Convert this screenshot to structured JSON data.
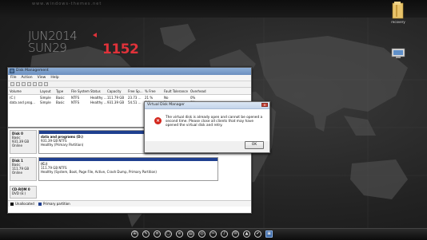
{
  "desktop": {
    "top_text": "www.windows-themes.net",
    "clock": {
      "date_line1": "JUN2014",
      "date_line2": "SUN29",
      "time": "1152"
    },
    "icons": [
      {
        "label": "recovery",
        "icon": "folder-icon"
      },
      {
        "label": "",
        "icon": "desktop-shortcut-icon"
      }
    ]
  },
  "disk_manager": {
    "title": "Disk Management",
    "menu": [
      "File",
      "Action",
      "View",
      "Help"
    ],
    "table": {
      "columns": [
        "Volume",
        "Layout",
        "Type",
        "File System",
        "Status",
        "Capacity",
        "Free Sp...",
        "% Free",
        "Fault Tolerance",
        "Overhead"
      ],
      "rows": [
        [
          "(C:)",
          "Simple",
          "Basic",
          "NTFS",
          "Healthy ...",
          "111.79 GB",
          "23.73 ...",
          "21 %",
          "No",
          "0%"
        ],
        [
          "data and prog...",
          "Simple",
          "Basic",
          "NTFS",
          "Healthy ...",
          "931.39 GB",
          "54.51 ...",
          "6 %",
          "No",
          "0%"
        ]
      ]
    },
    "disks": [
      {
        "name": "Disk 0",
        "type": "Basic",
        "size": "931.39 GB",
        "status": "Online",
        "partition": {
          "label": "data and programs (D:)",
          "detail1": "931.39 GB NTFS",
          "detail2": "Healthy (Primary Partition)"
        }
      },
      {
        "name": "Disk 1",
        "type": "Basic",
        "size": "111.79 GB",
        "status": "Online",
        "partition": {
          "label": "(C:)",
          "detail1": "111.79 GB NTFS",
          "detail2": "Healthy (System, Boot, Page File, Active, Crash Dump, Primary Partition)"
        }
      },
      {
        "name": "CD-ROM 0",
        "type": "DVD (E:)",
        "size": "",
        "status": "",
        "partition": {
          "label": "",
          "detail1": "",
          "detail2": ""
        }
      }
    ],
    "legend": [
      "Unallocated",
      "Primary partition"
    ]
  },
  "dialog": {
    "title": "Virtual Disk Manager",
    "message": "The virtual disk is already open and cannot be opened a second time. Please close all clients that may have opened the virtual disk and retry.",
    "ok_label": "OK"
  },
  "taskbar": {
    "icons": [
      "windows-start-icon",
      "pin-icon",
      "bar-icon",
      "window-icon",
      "ie-icon",
      "control-panel-icon",
      "disk-icon",
      "cut-icon",
      "music-icon",
      "chat-icon",
      "up-icon",
      "check-icon",
      "disk-manager-icon"
    ]
  },
  "colors": {
    "accent_red": "#e0323a",
    "partition_blue": "#1f3f8f",
    "unallocated_black": "#111111"
  }
}
